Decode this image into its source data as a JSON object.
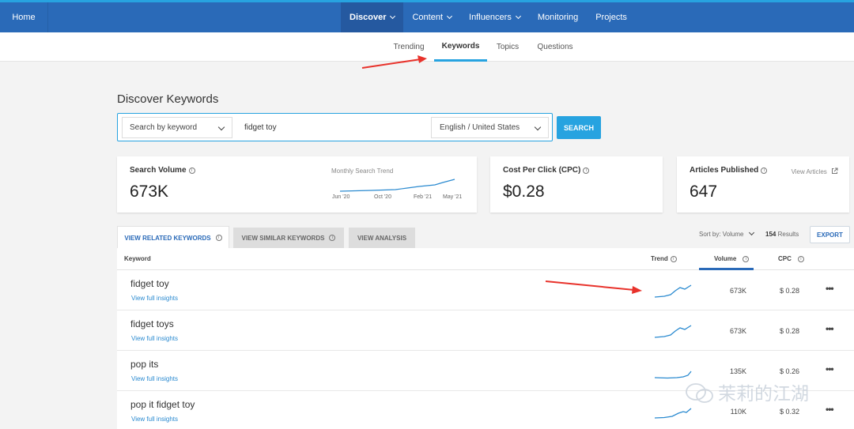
{
  "topnav": {
    "home": "Home",
    "items": [
      {
        "label": "Discover",
        "caret": true,
        "active": true
      },
      {
        "label": "Content",
        "caret": true,
        "active": false
      },
      {
        "label": "Influencers",
        "caret": true,
        "active": false
      },
      {
        "label": "Monitoring",
        "caret": false,
        "active": false
      },
      {
        "label": "Projects",
        "caret": false,
        "active": false
      }
    ]
  },
  "subnav": {
    "tabs": [
      "Trending",
      "Keywords",
      "Topics",
      "Questions"
    ],
    "active": "Keywords"
  },
  "page_title": "Discover Keywords",
  "search": {
    "mode": "Search by keyword",
    "query": "fidget toy",
    "locale": "English / United States",
    "button": "SEARCH"
  },
  "cards": {
    "search_volume": {
      "label": "Search Volume",
      "value": "673K",
      "trend_label": "Monthly Search Trend",
      "months": [
        "Jun '20",
        "Oct '20",
        "Feb '21",
        "May '21"
      ]
    },
    "cpc": {
      "label": "Cost Per Click (CPC)",
      "value": "$0.28"
    },
    "articles": {
      "label": "Articles Published",
      "value": "647",
      "link": "View Articles"
    }
  },
  "keyword_tabs": [
    "VIEW RELATED KEYWORDS",
    "VIEW SIMILAR KEYWORDS",
    "VIEW ANALYSIS"
  ],
  "toolbar": {
    "sort": "Sort by: Volume",
    "results_count": "154",
    "results_label": "Results",
    "export": "EXPORT"
  },
  "table": {
    "headers": {
      "keyword": "Keyword",
      "trend": "Trend",
      "volume": "Volume",
      "cpc": "CPC"
    },
    "rows": [
      {
        "keyword": "fidget toy",
        "link": "View full insights",
        "volume": "673K",
        "cpc": "$ 0.28"
      },
      {
        "keyword": "fidget toys",
        "link": "View full insights",
        "volume": "673K",
        "cpc": "$ 0.28"
      },
      {
        "keyword": "pop its",
        "link": "View full insights",
        "volume": "135K",
        "cpc": "$ 0.26"
      },
      {
        "keyword": "pop it fidget toy",
        "link": "View full insights",
        "volume": "110K",
        "cpc": "$ 0.32"
      }
    ]
  },
  "watermark": "茉莉的江湖",
  "colors": {
    "nav": "#2a6ab8",
    "accent": "#27a3e0",
    "arrow": "#e8322b"
  }
}
